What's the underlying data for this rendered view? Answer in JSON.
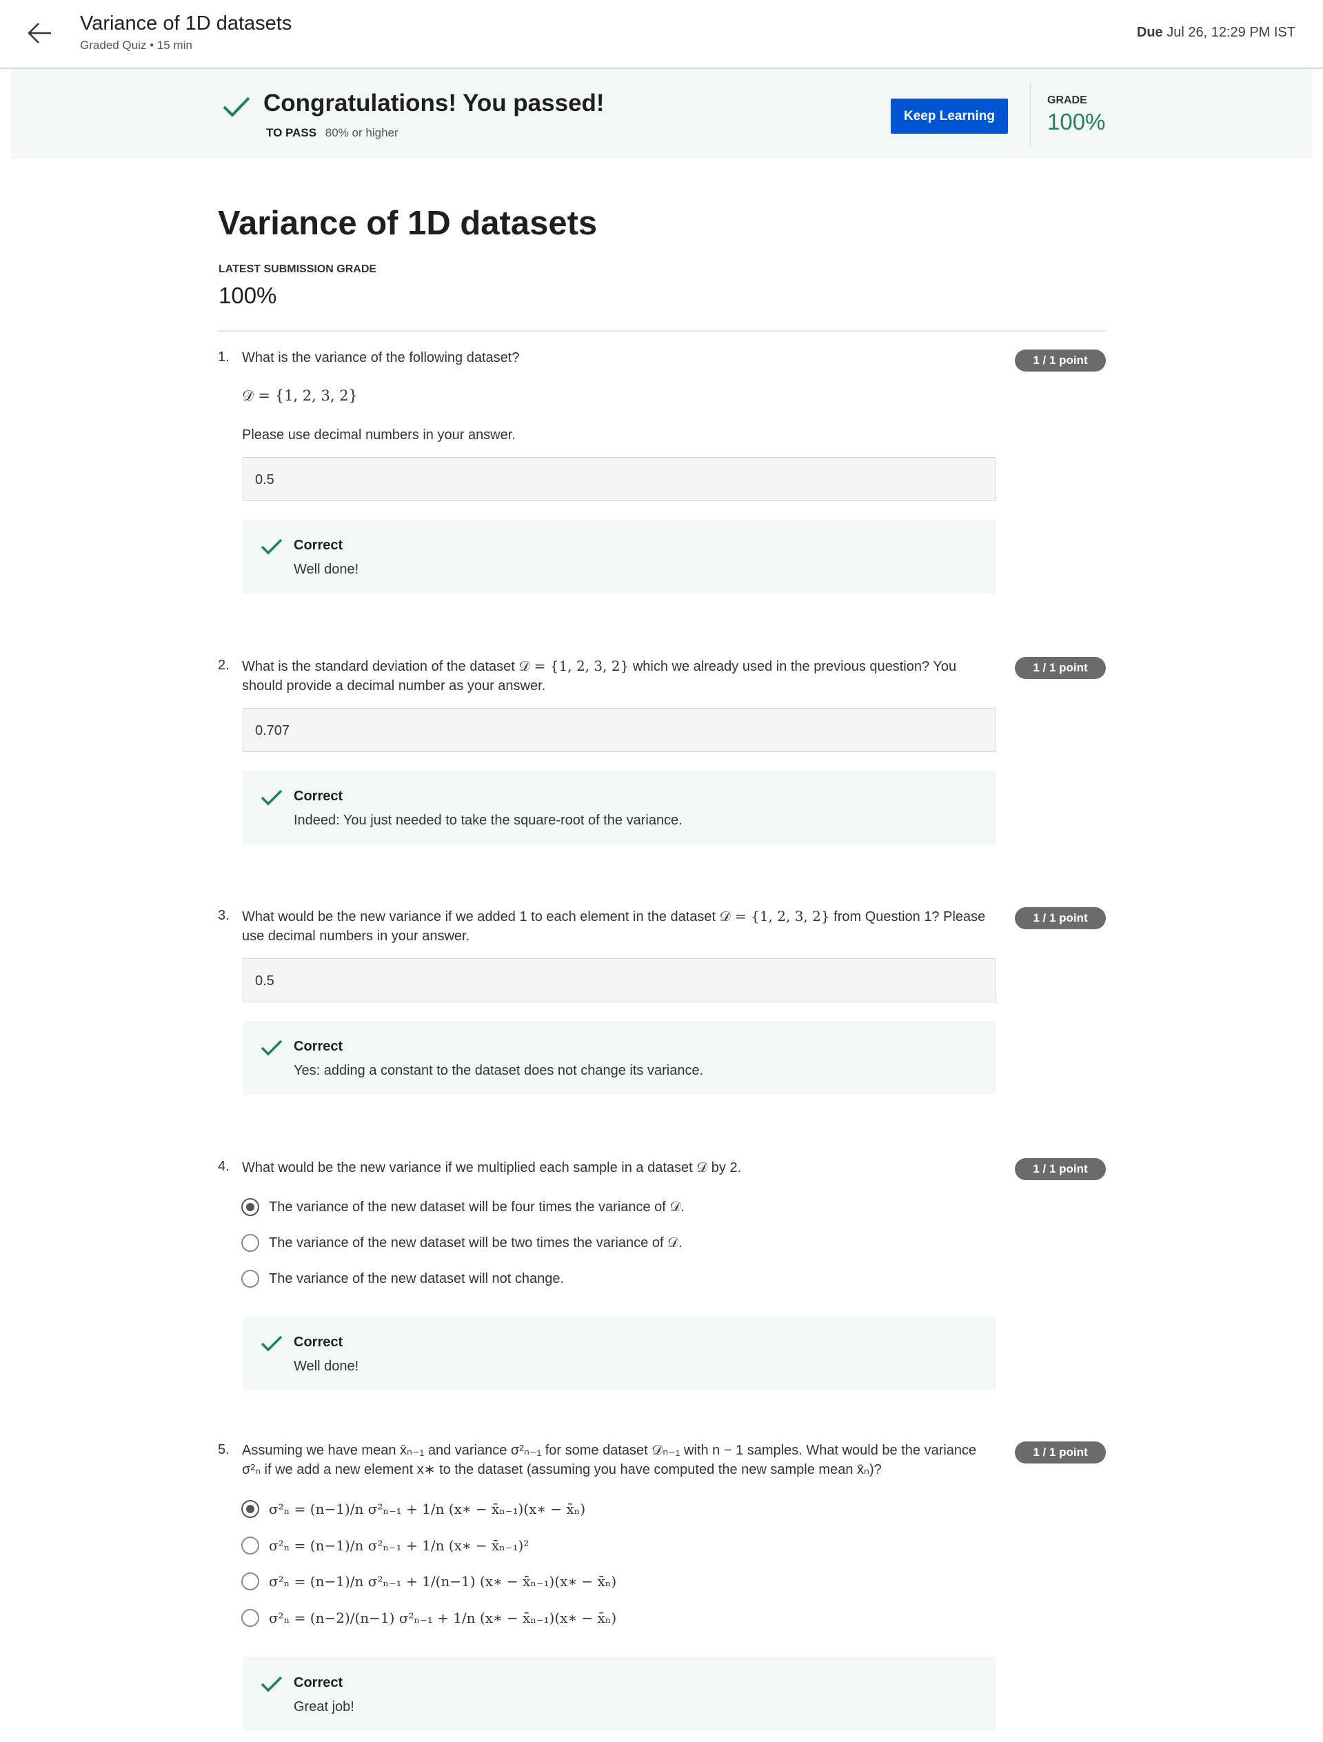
{
  "header": {
    "title": "Variance of 1D datasets",
    "subtitle": "Graded Quiz • 15 min",
    "due_label": "Due",
    "due_value": "Jul 26, 12:29 PM IST"
  },
  "banner": {
    "message": "Congratulations! You passed!",
    "to_pass_label": "TO PASS",
    "to_pass_value": "80% or higher",
    "keep_learning": "Keep Learning",
    "grade_label": "GRADE",
    "grade_value": "100%"
  },
  "main": {
    "title": "Variance of 1D datasets",
    "latest_label": "LATEST SUBMISSION GRADE",
    "latest_value": "100%"
  },
  "questions": [
    {
      "number": "1.",
      "text": "What is the variance of the following dataset?",
      "formula": "𝒟 = {1, 2, 3, 2}",
      "note": "Please use decimal numbers in your answer.",
      "answer": "0.5",
      "points": "1 / 1 point",
      "feedback_title": "Correct",
      "feedback_text": "Well done!"
    },
    {
      "number": "2.",
      "text_a": "What is the standard deviation of the dataset ",
      "formula": "𝒟 = {1, 2, 3, 2}",
      "text_b": " which we already used in the previous question? You should provide a decimal number as your answer.",
      "answer": "0.707",
      "points": "1 / 1 point",
      "feedback_title": "Correct",
      "feedback_text": "Indeed: You just needed to take the square-root of the variance."
    },
    {
      "number": "3.",
      "text_a": "What would be the new variance if we added 1 to each element in the dataset ",
      "formula": "𝒟 = {1, 2, 3, 2}",
      "text_b": " from Question 1? Please use decimal numbers in your answer.",
      "answer": "0.5",
      "points": "1 / 1 point",
      "feedback_title": "Correct",
      "feedback_text": "Yes: adding a constant to the dataset does not change its variance."
    },
    {
      "number": "4.",
      "text_a": "What would be the new variance if we multiplied each sample in a dataset ",
      "formula": "𝒟",
      "text_b": " by 2.",
      "options": [
        "The variance of the new dataset will be four times the variance of 𝒟.",
        "The variance of the new dataset will be two times the variance of 𝒟.",
        "The variance of the new dataset will not change."
      ],
      "selected": 0,
      "points": "1 / 1 point",
      "feedback_title": "Correct",
      "feedback_text": "Well done!"
    },
    {
      "number": "5.",
      "text": "Assuming we have mean x̄ₙ₋₁ and variance σ²ₙ₋₁ for some dataset 𝒟ₙ₋₁ with n − 1 samples. What would be the variance σ²ₙ if we add a new element x∗ to the dataset (assuming you have computed the new sample mean x̄ₙ)?",
      "options": [
        "σ²ₙ = (n−1)/n σ²ₙ₋₁ + 1/n (x∗ − x̄ₙ₋₁)(x∗ − x̄ₙ)",
        "σ²ₙ = (n−1)/n σ²ₙ₋₁ + 1/n (x∗ − x̄ₙ₋₁)²",
        "σ²ₙ = (n−1)/n σ²ₙ₋₁ + 1/(n−1) (x∗ − x̄ₙ₋₁)(x∗ − x̄ₙ)",
        "σ²ₙ = (n−2)/(n−1) σ²ₙ₋₁ + 1/n (x∗ − x̄ₙ₋₁)(x∗ − x̄ₙ)"
      ],
      "selected": 0,
      "points": "1 / 1 point",
      "feedback_title": "Correct",
      "feedback_text": "Great job!"
    }
  ],
  "colors": {
    "accent_green": "#1f8354",
    "button_blue": "#0056d2",
    "points_badge": "#6b6b6b"
  }
}
